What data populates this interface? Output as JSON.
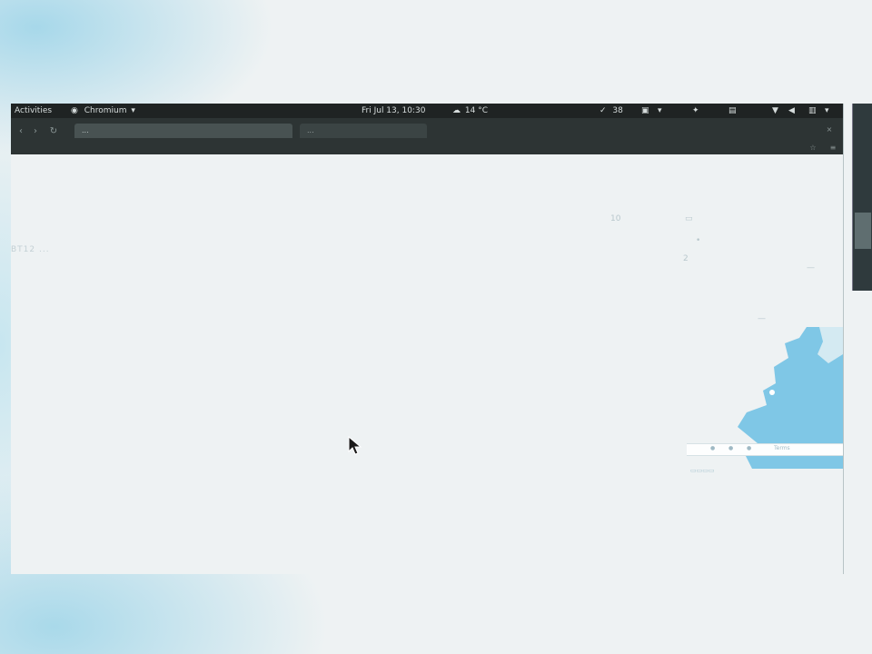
{
  "topbar": {
    "activities": "Activities",
    "app_name": "Chromium",
    "clock": "Fri Jul 13, 10:30",
    "weather": "14 °C",
    "battery_value": "38"
  },
  "browser": {
    "tab_active_label": "...",
    "tab_second_label": "...",
    "url_text": ""
  },
  "page": {
    "left_text": "BT12 ...",
    "right_labels": [
      "10",
      "2"
    ],
    "map_bar_label": "Terms"
  },
  "colors": {
    "sea": "#7fc7e6",
    "topbar_bg": "#1f2323",
    "browser_bg": "#2d3434",
    "page_bg": "#eef2f3"
  }
}
